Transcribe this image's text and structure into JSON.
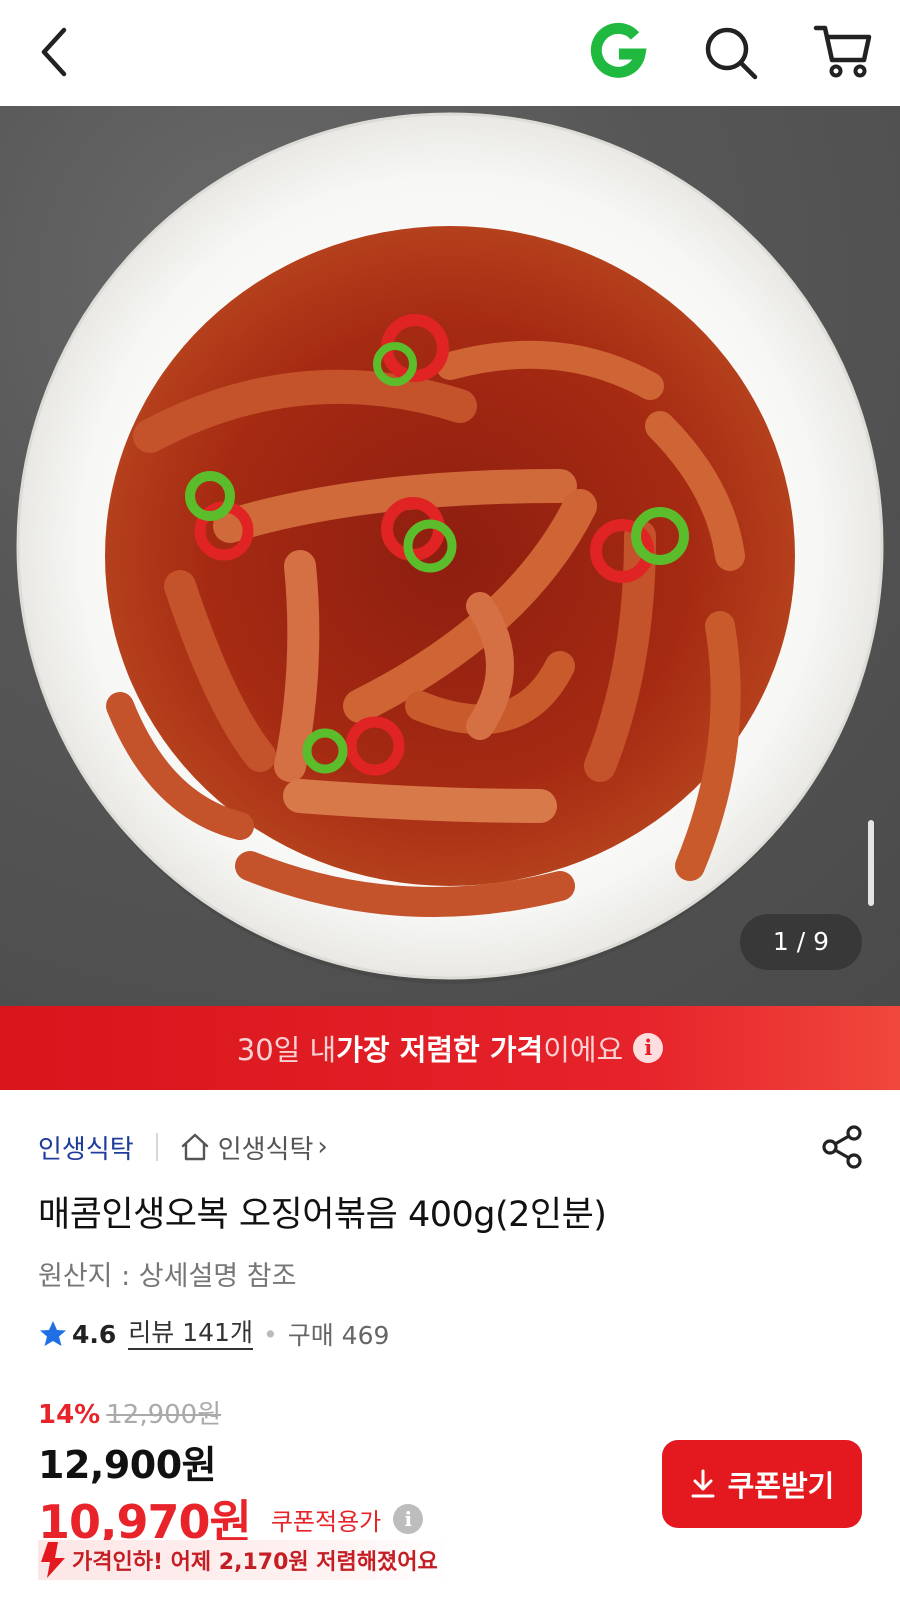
{
  "header": {
    "back_icon": "chevron-left-icon",
    "brand_icon": "gmarket-g-icon",
    "search_icon": "search-icon",
    "cart_icon": "cart-icon",
    "brand_color": "#1fb93f"
  },
  "gallery": {
    "counter": "1 / 9"
  },
  "banner": {
    "prefix": "30일 내 ",
    "highlight": "가장 저렴한 가격",
    "suffix": "이에요",
    "info_glyph": "i"
  },
  "product": {
    "seller": "인생식탁",
    "store_link": "인생식탁",
    "store_chevron": "›",
    "title": "매콤인생오복 오징어볶음 400g(2인분)",
    "origin": "원산지 : 상세설명 참조",
    "rating": "4.6",
    "reviews": "리뷰 141개",
    "dot": "•",
    "purchases": "구매 469",
    "discount_pct": "14%",
    "original_price": "12,900원",
    "price": "12,900원",
    "coupon_price": "10,970원",
    "coupon_label": "쿠폰적용가",
    "coupon_info_glyph": "i",
    "price_drop": "가격인하! 어제 2,170원 저렴해졌어요"
  },
  "actions": {
    "coupon_button": "쿠폰받기"
  },
  "colors": {
    "accent_red": "#e3191f",
    "seller_blue": "#1d3c9c",
    "star_blue": "#1f6fe5"
  }
}
